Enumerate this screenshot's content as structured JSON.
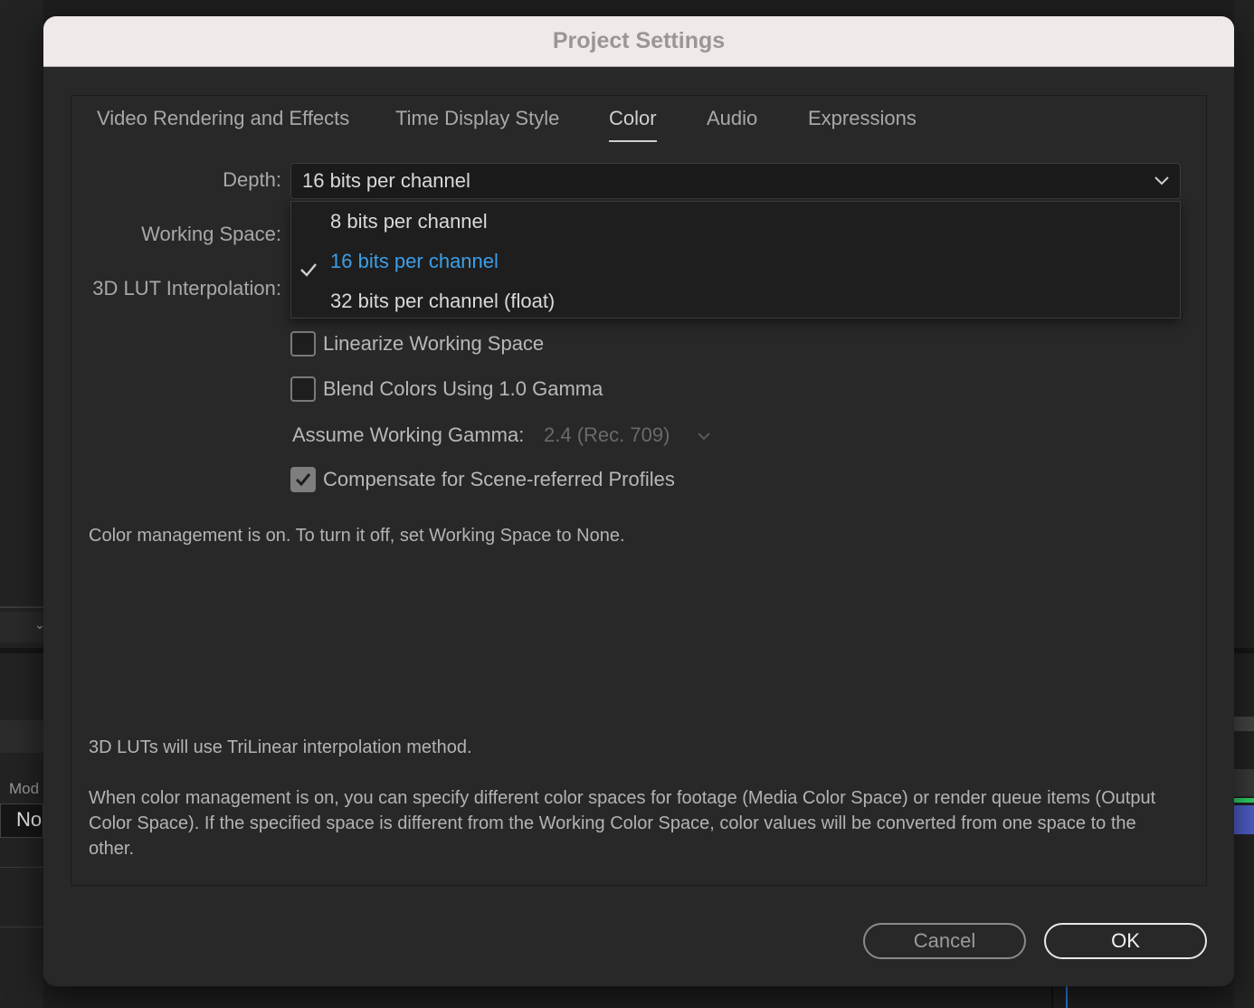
{
  "background": {
    "mode_label": "Mod",
    "no_label": "No"
  },
  "dialog": {
    "title": "Project Settings"
  },
  "tabs": [
    {
      "label": "Video Rendering and Effects"
    },
    {
      "label": "Time Display Style"
    },
    {
      "label": "Color",
      "active": true
    },
    {
      "label": "Audio"
    },
    {
      "label": "Expressions"
    }
  ],
  "color": {
    "depth_label": "Depth:",
    "depth_value": "16 bits per channel",
    "working_space_label": "Working Space:",
    "lut_label": "3D LUT Interpolation:",
    "depth_options": [
      {
        "label": "8 bits per channel",
        "selected": false
      },
      {
        "label": "16 bits per channel",
        "selected": true
      },
      {
        "label": "32 bits per channel (float)",
        "selected": false
      }
    ],
    "linearize": {
      "label": "Linearize Working Space",
      "checked": false
    },
    "blend": {
      "label": "Blend Colors Using 1.0 Gamma",
      "checked": false
    },
    "gamma_label": "Assume Working Gamma:",
    "gamma_value": "2.4 (Rec. 709)",
    "compensate": {
      "label": "Compensate for Scene-referred Profiles",
      "checked": true
    },
    "info_management": "Color management is on. To turn it off, set Working Space to None.",
    "info_lut": "3D LUTs will use TriLinear interpolation method.",
    "info_spaces": "When color management is on, you can specify different color spaces for footage (Media Color Space) or render queue items (Output Color Space). If the specified space is different from the Working Color Space, color values will be converted from one space to the other."
  },
  "buttons": {
    "cancel": "Cancel",
    "ok": "OK"
  },
  "colors": {
    "accent": "#3d9ee8",
    "dialog_bg": "#282828",
    "titlebar_bg": "#efe9e9"
  }
}
